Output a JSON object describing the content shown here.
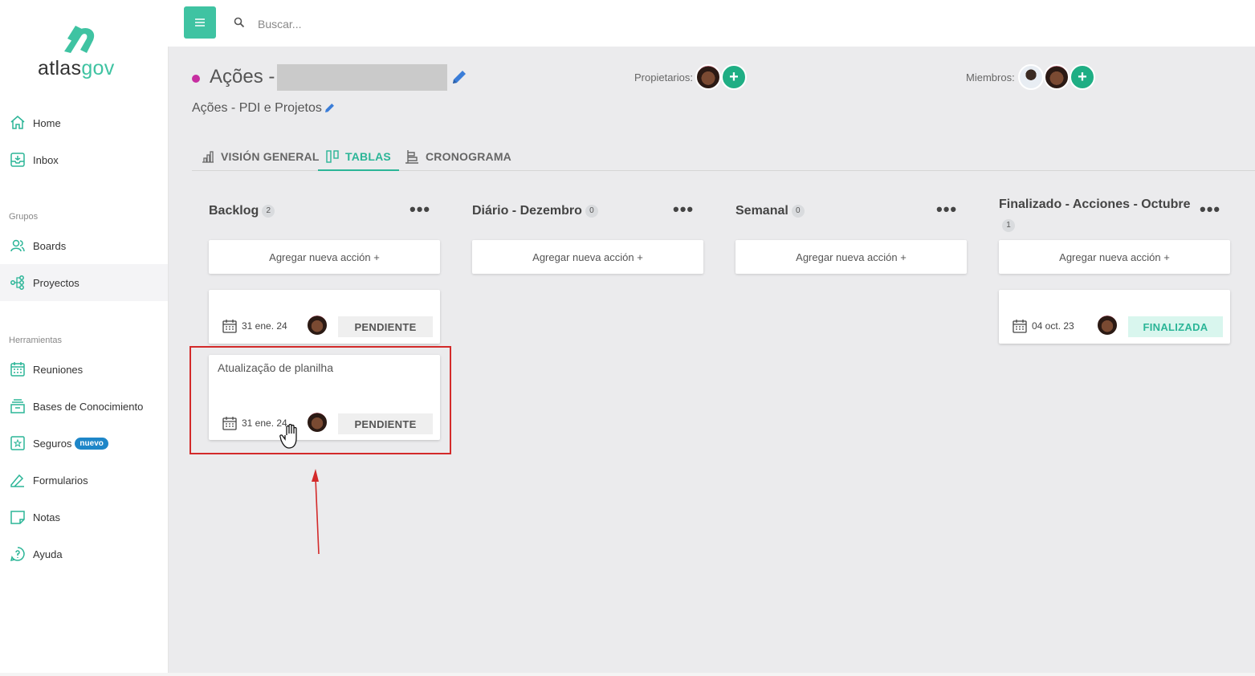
{
  "brand": {
    "part1": "atlas",
    "part2": "gov",
    "accent": "#3fc3a2"
  },
  "sidebar": {
    "top_items": [
      {
        "label": "Home",
        "icon": "home-icon"
      },
      {
        "label": "Inbox",
        "icon": "inbox-icon"
      }
    ],
    "groups_label": "Grupos",
    "group_items": [
      {
        "label": "Boards",
        "icon": "users-icon"
      },
      {
        "label": "Proyectos",
        "icon": "project-icon",
        "active": true
      }
    ],
    "tools_label": "Herramientas",
    "tool_items": [
      {
        "label": "Reuniones",
        "icon": "calendar-icon"
      },
      {
        "label": "Bases de Conocimiento",
        "icon": "archive-icon"
      },
      {
        "label": "Seguros",
        "icon": "safe-icon",
        "badge": "nuevo"
      },
      {
        "label": "Formularios",
        "icon": "form-icon"
      },
      {
        "label": "Notas",
        "icon": "note-icon"
      },
      {
        "label": "Ayuda",
        "icon": "help-icon"
      }
    ]
  },
  "topbar": {
    "search_placeholder": "Buscar..."
  },
  "project": {
    "title": "Ações -",
    "subtitle": "Ações - PDI e Projetos",
    "dot_color": "#c72ea1",
    "owners_label": "Propietarios:",
    "members_label": "Miembros:"
  },
  "tabs": [
    {
      "label": "VISIÓN GENERAL",
      "icon": "chart-icon"
    },
    {
      "label": "TABLAS",
      "icon": "board-icon",
      "active": true
    },
    {
      "label": "CRONOGRAMA",
      "icon": "timeline-icon"
    }
  ],
  "columns": [
    {
      "name": "Backlog",
      "count": "2",
      "add_label": "Agregar nueva acción +",
      "cards": [
        {
          "title": "",
          "date": "31 ene. 24",
          "status": "PENDIENTE"
        },
        {
          "title": "Atualização de planilha",
          "date": "31 ene. 24",
          "status": "PENDIENTE"
        }
      ]
    },
    {
      "name": "Diário - Dezembro",
      "count": "0",
      "add_label": "Agregar nueva acción +",
      "cards": []
    },
    {
      "name": "Semanal",
      "count": "0",
      "add_label": "Agregar nueva acción +",
      "cards": []
    },
    {
      "name": "Finalizado - Acciones - Octubre",
      "count": "1",
      "add_label": "Agregar nueva acción +",
      "cards": [
        {
          "title": "",
          "date": "04 oct. 23",
          "status": "FINALIZADA"
        }
      ]
    }
  ],
  "colors": {
    "primary": "#3fc3a2",
    "tab_active": "#2bb597",
    "pending_bg": "#efefef",
    "final_bg": "#d9f6ee",
    "annotation": "#d32a2a"
  }
}
